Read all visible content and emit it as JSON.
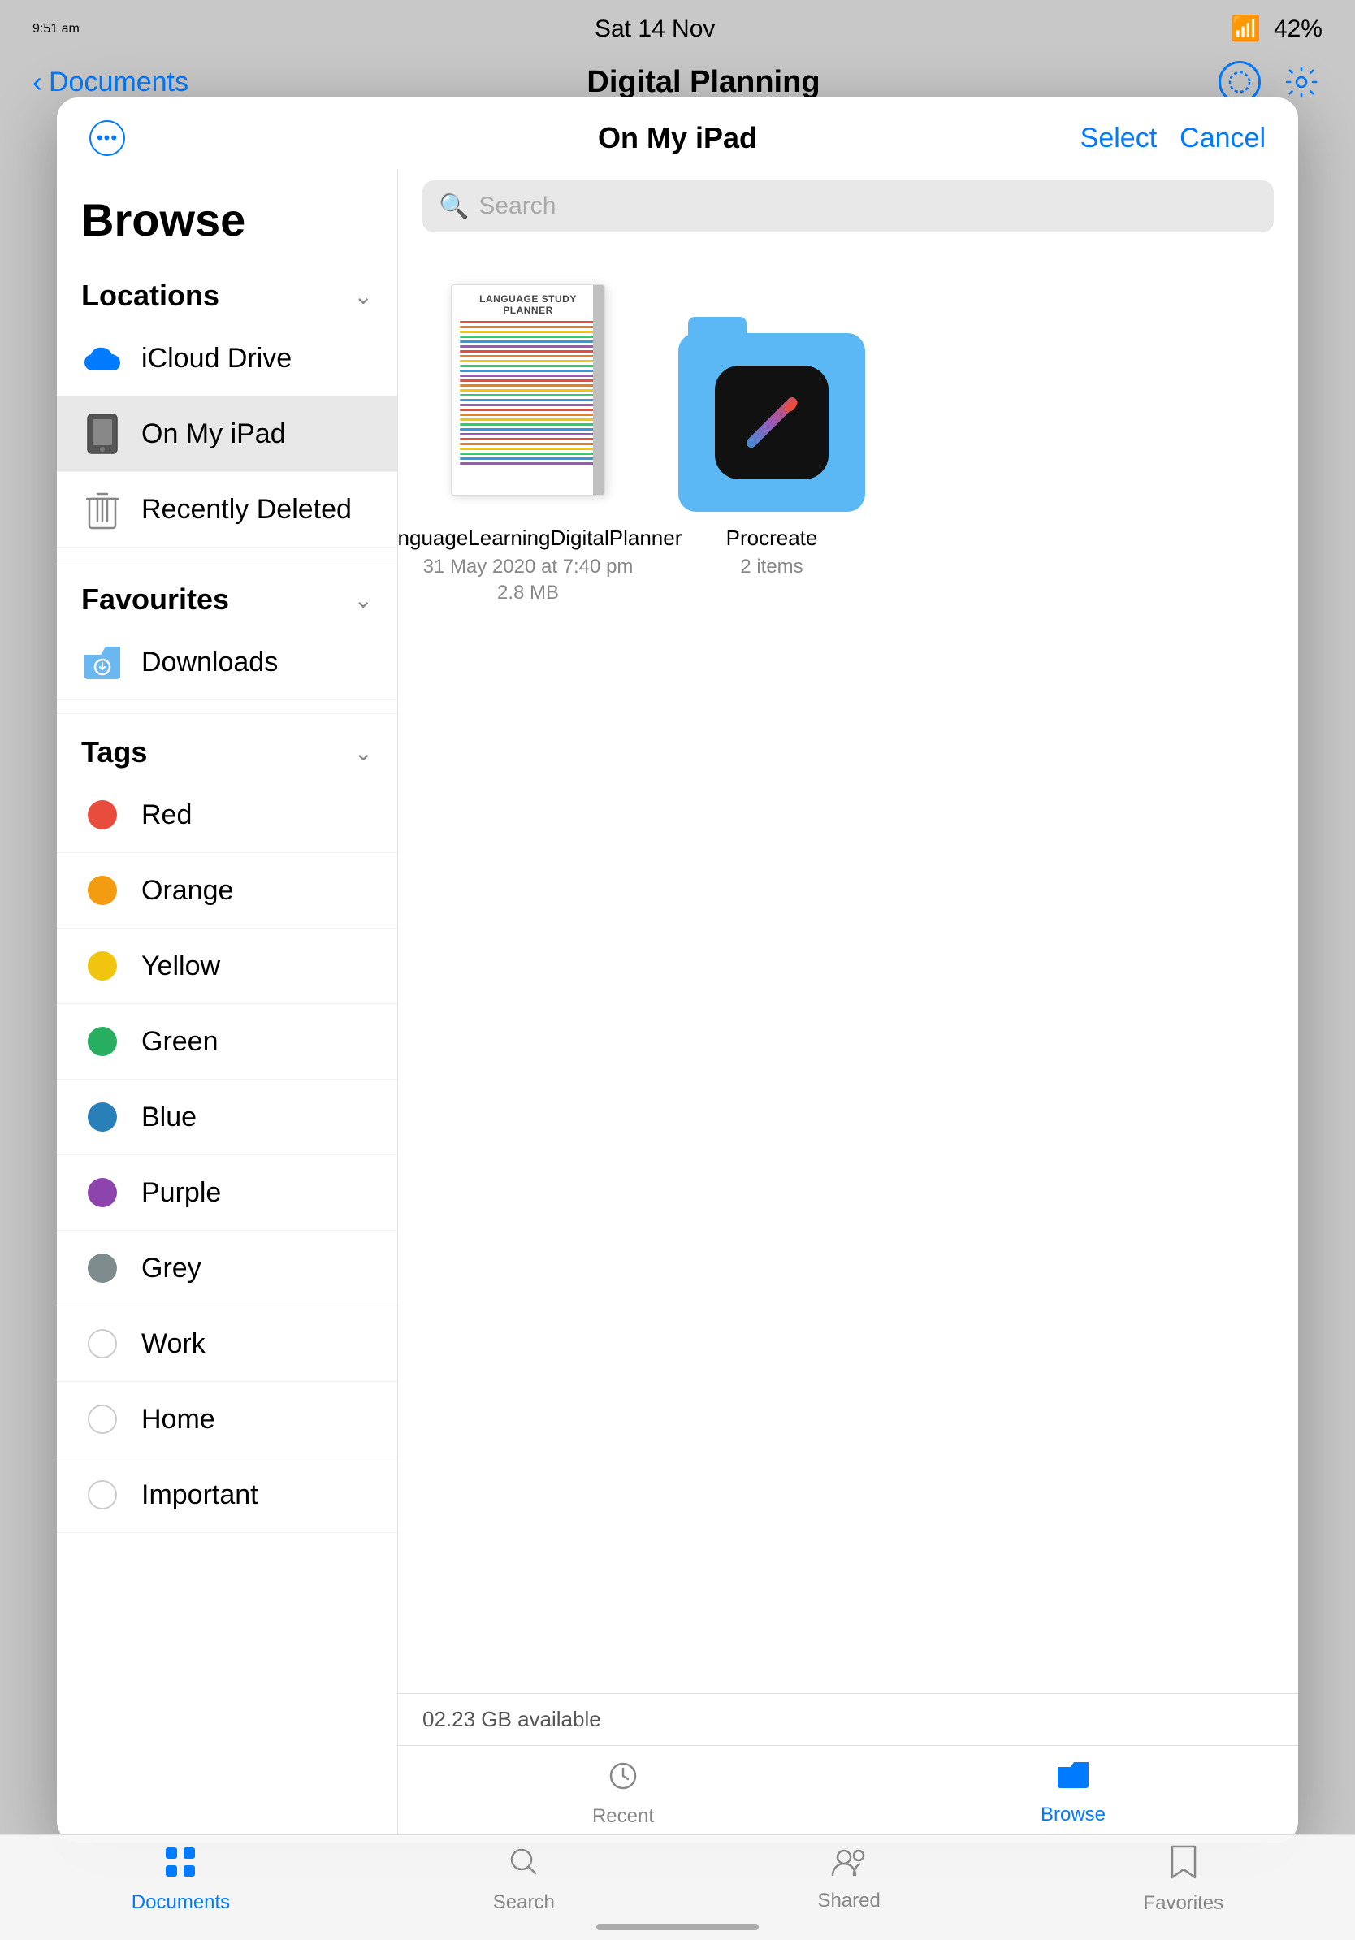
{
  "statusBar": {
    "time": "9:51 am",
    "date": "Sat 14 Nov",
    "battery": "42%",
    "wifi": true
  },
  "appBar": {
    "backLabel": "Documents",
    "title": "Digital Planning"
  },
  "modal": {
    "header": {
      "locationTitle": "On My iPad",
      "selectLabel": "Select",
      "cancelLabel": "Cancel"
    },
    "sidebar": {
      "browseTitle": "Browse",
      "locationsSection": "Locations",
      "locations": [
        {
          "id": "icloud",
          "label": "iCloud Drive",
          "icon": "icloud"
        },
        {
          "id": "on-my-ipad",
          "label": "On My iPad",
          "icon": "ipad",
          "active": true
        },
        {
          "id": "recently-deleted",
          "label": "Recently Deleted",
          "icon": "trash"
        }
      ],
      "favouritesSection": "Favourites",
      "favourites": [
        {
          "id": "downloads",
          "label": "Downloads",
          "icon": "folder-clock"
        }
      ],
      "tagsSection": "Tags",
      "tags": [
        {
          "id": "red",
          "label": "Red",
          "color": "#e74c3c",
          "empty": false
        },
        {
          "id": "orange",
          "label": "Orange",
          "color": "#f39c12",
          "empty": false
        },
        {
          "id": "yellow",
          "label": "Yellow",
          "color": "#f1c40f",
          "empty": false
        },
        {
          "id": "green",
          "label": "Green",
          "color": "#27ae60",
          "empty": false
        },
        {
          "id": "blue",
          "label": "Blue",
          "color": "#2980b9",
          "empty": false
        },
        {
          "id": "purple",
          "label": "Purple",
          "color": "#8e44ad",
          "empty": false
        },
        {
          "id": "grey",
          "label": "Grey",
          "color": "#7f8c8d",
          "empty": false
        },
        {
          "id": "work",
          "label": "Work",
          "color": "",
          "empty": true
        },
        {
          "id": "home",
          "label": "Home",
          "color": "",
          "empty": true
        },
        {
          "id": "important",
          "label": "Important",
          "color": "",
          "empty": true
        }
      ]
    },
    "content": {
      "files": [
        {
          "id": "language-planner",
          "name": "LanguageLearningDigitalPlanner",
          "date": "31 May 2020 at 7:40 pm",
          "size": "2.8 MB",
          "type": "planner"
        },
        {
          "id": "procreate",
          "name": "Procreate",
          "items": "2 items",
          "type": "folder"
        }
      ]
    },
    "storage": "02.23 GB available",
    "tabs": [
      {
        "id": "recent",
        "label": "Recent",
        "icon": "clock",
        "active": false
      },
      {
        "id": "browse",
        "label": "Browse",
        "icon": "folder",
        "active": true
      }
    ]
  },
  "bottomBar": {
    "tabs": [
      {
        "id": "documents",
        "label": "Documents",
        "icon": "grid",
        "active": true
      },
      {
        "id": "search",
        "label": "Search",
        "icon": "search",
        "active": false
      },
      {
        "id": "shared",
        "label": "Shared",
        "icon": "shared",
        "active": false
      },
      {
        "id": "favorites",
        "label": "Favorites",
        "icon": "bookmark",
        "active": false
      }
    ]
  },
  "plannerLines": [
    "#e74c3c",
    "#e67e22",
    "#f1c40f",
    "#2ecc71",
    "#3498db",
    "#9b59b6",
    "#e74c3c",
    "#e67e22",
    "#f1c40f",
    "#2ecc71",
    "#3498db",
    "#9b59b6",
    "#e74c3c",
    "#e67e22",
    "#f1c40f",
    "#2ecc71",
    "#3498db",
    "#9b59b6",
    "#e74c3c",
    "#e67e22",
    "#f1c40f",
    "#2ecc71",
    "#3498db",
    "#9b59b6",
    "#e74c3c",
    "#e67e22",
    "#f1c40f",
    "#2ecc71",
    "#3498db",
    "#9b59b6"
  ]
}
